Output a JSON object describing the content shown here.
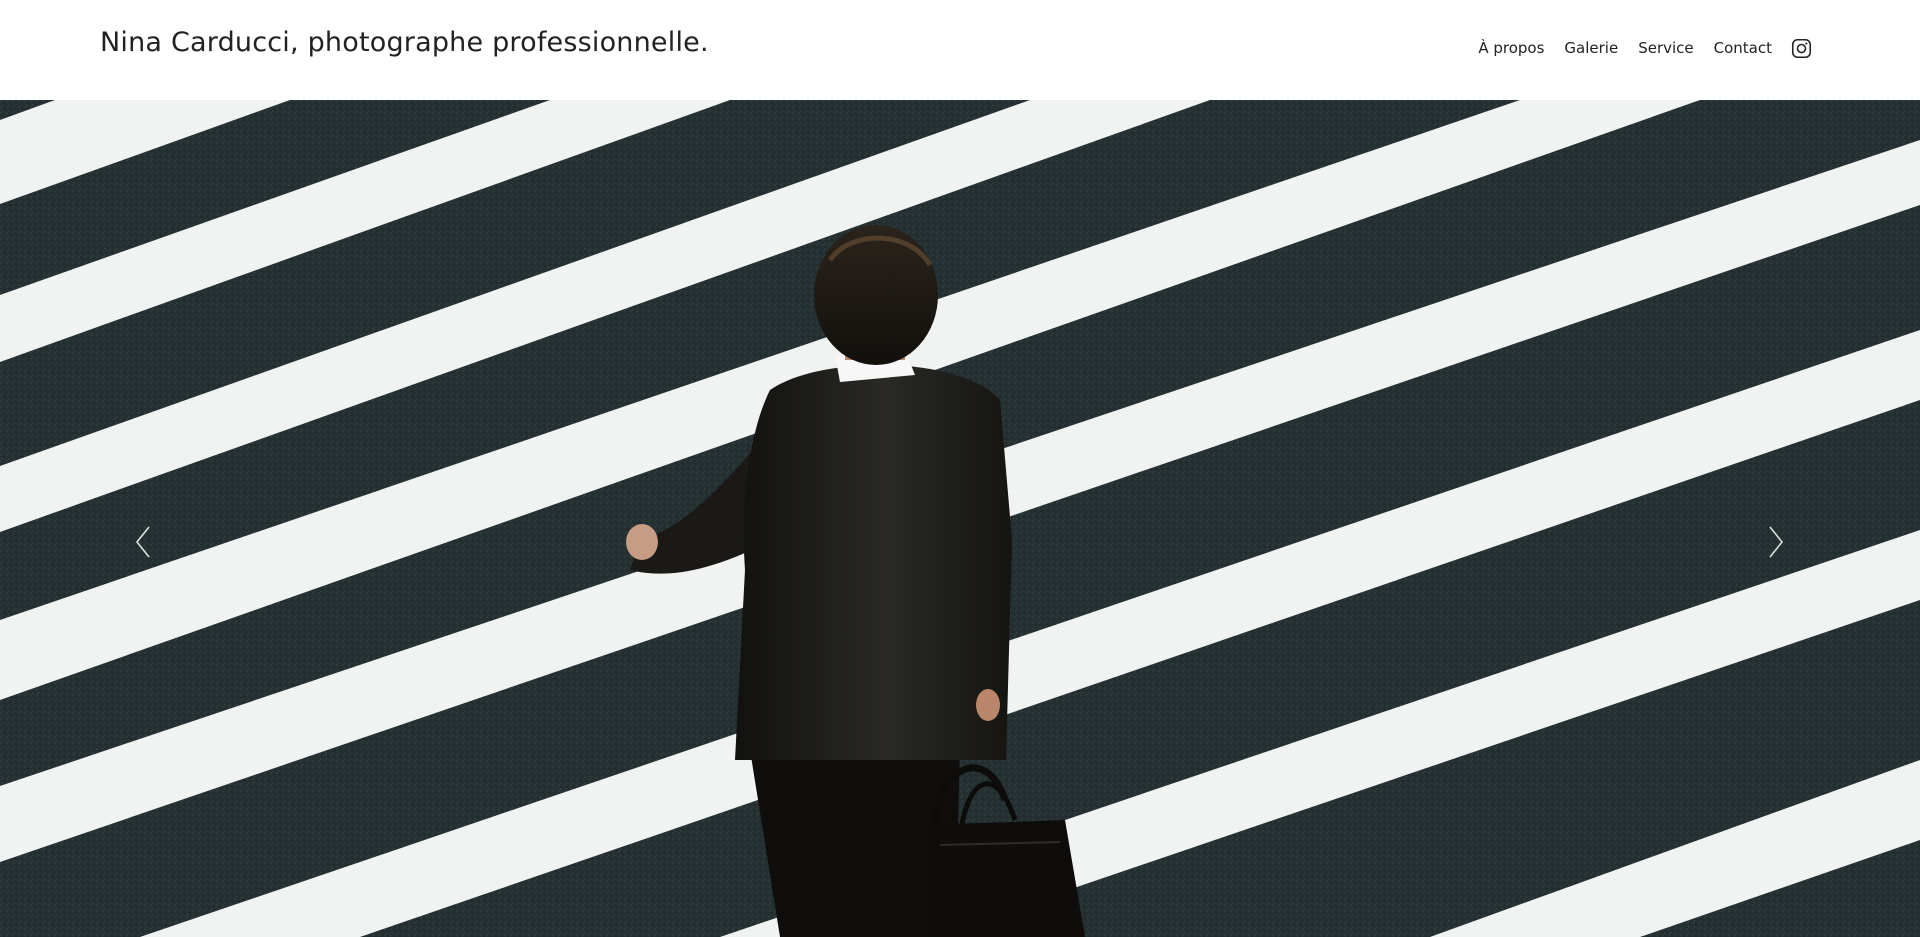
{
  "header": {
    "title": "Nina Carducci, photographe professionnelle."
  },
  "nav": {
    "items": [
      {
        "label": "À propos"
      },
      {
        "label": "Galerie"
      },
      {
        "label": "Service"
      },
      {
        "label": "Contact"
      }
    ],
    "social_icon": "instagram-icon"
  },
  "hero": {
    "image_subject": "man in dark suit with black bag crossing a zebra crosswalk",
    "prev_icon": "chevron-left-icon",
    "next_icon": "chevron-right-icon"
  },
  "colors": {
    "text": "#222222",
    "background": "#ffffff",
    "asphalt": "#263033",
    "stripe": "#f2f3f3",
    "suit": "#1b1a17"
  }
}
